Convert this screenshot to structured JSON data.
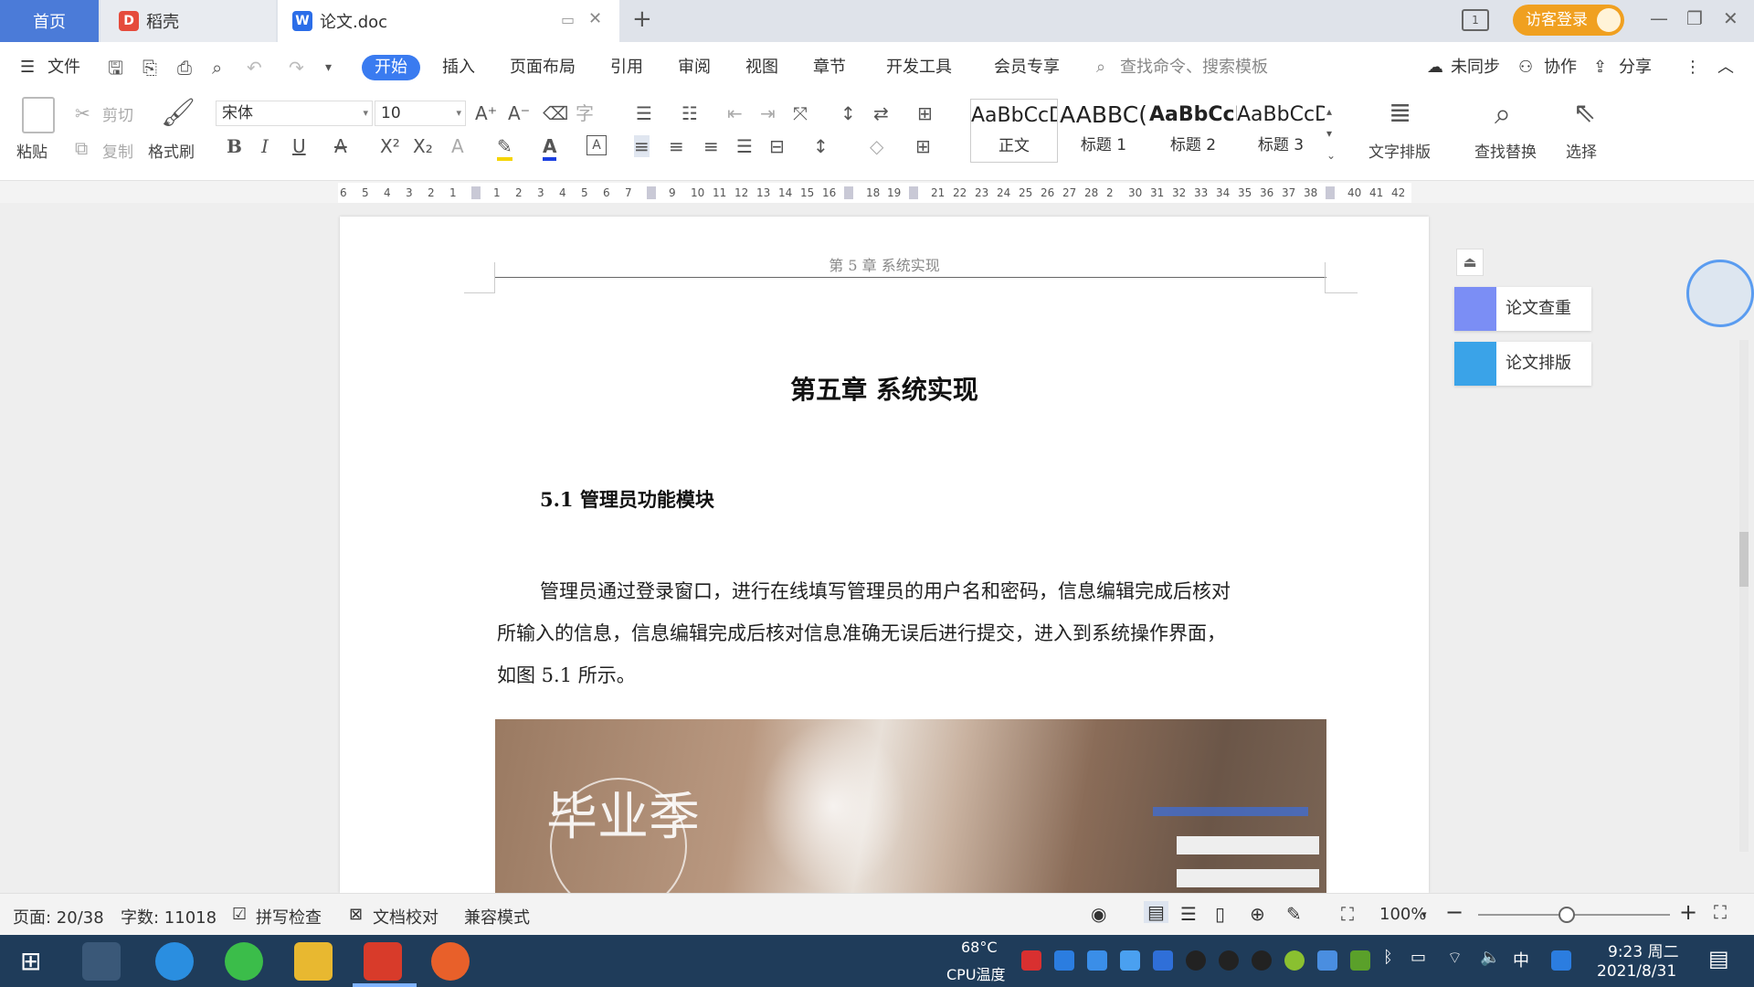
{
  "tabs": {
    "home": "首页",
    "daoke": "稻壳",
    "doc": "论文.doc"
  },
  "titlebar": {
    "guest_login": "访客登录"
  },
  "menu": {
    "file": "文件",
    "items": [
      "开始",
      "插入",
      "页面布局",
      "引用",
      "审阅",
      "视图",
      "章节",
      "开发工具",
      "会员专享"
    ],
    "search_placeholder": "查找命令、搜索模板",
    "sync": "未同步",
    "collab": "协作",
    "share": "分享"
  },
  "toolbar": {
    "paste": "粘贴",
    "cut": "剪切",
    "copy": "复制",
    "format_painter": "格式刷",
    "font_name": "宋体",
    "font_size": "10",
    "styles": [
      {
        "preview": "AaBbCcD",
        "name": "正文"
      },
      {
        "preview": "AABBC(",
        "name": "标题 1"
      },
      {
        "preview": "AaBbCcD",
        "name": "标题 2"
      },
      {
        "preview": "AaBbCcDc",
        "name": "标题 3"
      }
    ],
    "text_layout": "文字排版",
    "find_replace": "查找替换",
    "select": "选择"
  },
  "ruler": {
    "ticks": [
      "6",
      "5",
      "4",
      "3",
      "2",
      "1",
      "",
      "1",
      "2",
      "3",
      "4",
      "5",
      "6",
      "7",
      "",
      "9",
      "10",
      "11",
      "12",
      "13",
      "14",
      "15",
      "16",
      "",
      "18",
      "19",
      "",
      "21",
      "22",
      "23",
      "24",
      "25",
      "26",
      "27",
      "28",
      "2",
      "30",
      "31",
      "32",
      "33",
      "34",
      "35",
      "36",
      "37",
      "38",
      "",
      "40",
      "41",
      "42"
    ]
  },
  "document": {
    "header": "第 5 章  系统实现",
    "chapter_title": "第五章  系统实现",
    "section_title": "5.1 管理员功能模块",
    "paragraph_lines": [
      "管理员通过登录窗口，进行在线填写管理员的用户名和密码，信息编辑完成后核对",
      "所输入的信息，信息编辑完成后核对信息准确无误后进行提交，进入到系统操作界面，",
      "如图 5.1 所示。"
    ],
    "figure_text": "毕业季"
  },
  "side_panel": {
    "check": "论文查重",
    "layout": "论文排版"
  },
  "status": {
    "page": "页面: 20/38",
    "words": "字数: 11018",
    "spell": "拼写检查",
    "proof": "文档校对",
    "compat": "兼容模式",
    "zoom": "100%"
  },
  "taskbar": {
    "cpu_temp": "68°C",
    "cpu_label": "CPU温度",
    "ime": "中",
    "time": "9:23 周二",
    "date": "2021/8/31"
  },
  "colors": {
    "accent": "#3a7bf0",
    "tab_home": "#4b7bd8",
    "guest": "#f0a020",
    "taskbar": "#1f3c5a"
  }
}
